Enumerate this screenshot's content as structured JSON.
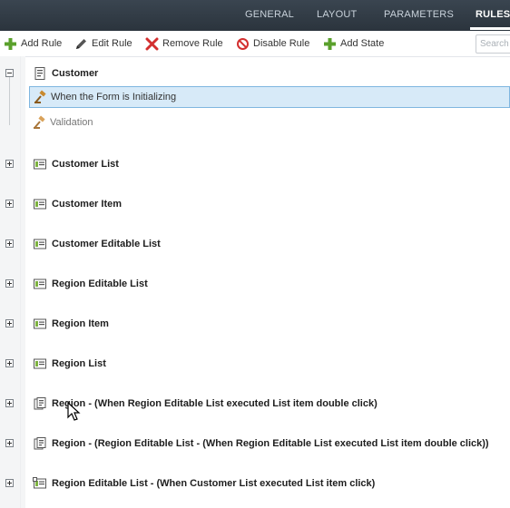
{
  "tabs": [
    {
      "label": "GENERAL",
      "active": false
    },
    {
      "label": "LAYOUT",
      "active": false
    },
    {
      "label": "PARAMETERS",
      "active": false
    },
    {
      "label": "RULES",
      "active": true
    }
  ],
  "toolbar": {
    "add_rule": "Add Rule",
    "edit_rule": "Edit Rule",
    "remove_rule": "Remove Rule",
    "disable_rule": "Disable Rule",
    "add_state": "Add State",
    "search_placeholder": "Search"
  },
  "tree": {
    "root": {
      "label": "Customer",
      "icon": "form-icon",
      "expanded": true
    },
    "events": [
      {
        "label": "When the Form is Initializing",
        "icon": "gavel-icon",
        "selected": true
      },
      {
        "label": "Validation",
        "icon": "gavel-icon",
        "selected": false
      }
    ],
    "nodes": [
      {
        "label": "Customer List",
        "icon": "view-icon"
      },
      {
        "label": "Customer Item",
        "icon": "view-icon"
      },
      {
        "label": "Customer Editable List",
        "icon": "view-icon"
      },
      {
        "label": "Region Editable List",
        "icon": "view-icon"
      },
      {
        "label": "Region Item",
        "icon": "view-icon"
      },
      {
        "label": "Region List",
        "icon": "view-icon"
      },
      {
        "label": "Region - (When Region Editable List executed List item double click)",
        "icon": "subform-icon"
      },
      {
        "label": "Region - (Region Editable List - (When Region Editable List executed List item double click))",
        "icon": "subform-icon"
      },
      {
        "label": "Region Editable List - (When Customer List executed List item click)",
        "icon": "subview-icon"
      }
    ]
  },
  "colors": {
    "tabbar_bg": "#2f3943",
    "selected_row_bg": "#d7eaf8",
    "selected_row_border": "#7fb6e0",
    "add_green": "#5aa02c",
    "remove_red": "#d32f2f"
  }
}
